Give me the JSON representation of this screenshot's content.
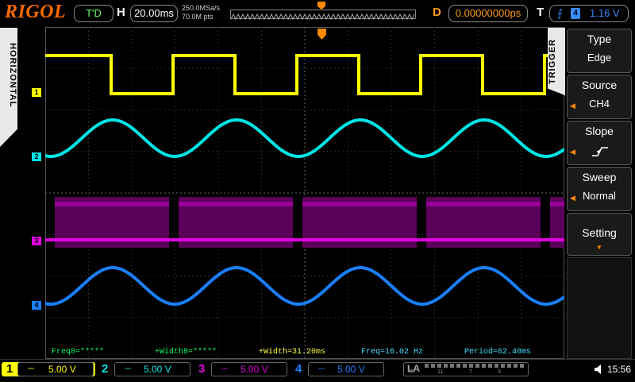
{
  "top": {
    "logo": "RIGOL",
    "status": "T'D",
    "h_label": "H",
    "timebase": "20.00ms",
    "sample_rate": "250.0MSa/s",
    "memory_depth": "70.0M pts",
    "d_label": "D",
    "delay": "0.00000000ps",
    "t_label": "T",
    "trigger_source_num": "4",
    "trigger_level": "1.16 V"
  },
  "left_tab": {
    "label": "HORIZONTAL"
  },
  "right_panel": {
    "tab_label": "TRIGGER",
    "items": [
      {
        "title": "Type",
        "value": "Edge"
      },
      {
        "title": "Source",
        "value": "CH4"
      },
      {
        "title": "Slope",
        "value": ""
      },
      {
        "title": "Sweep",
        "value": "Normal"
      },
      {
        "title": "Setting",
        "value": ""
      }
    ]
  },
  "channels": {
    "markers": [
      "1",
      "2",
      "3",
      "4"
    ],
    "colors": [
      "#ffff00",
      "#00e5e5",
      "#e000e0",
      "#1a7fff"
    ]
  },
  "measurements": [
    {
      "text": "Freq8=*****",
      "color": "#00ff66"
    },
    {
      "text": "+Width8=*****",
      "color": "#00ff66"
    },
    {
      "text": "+Width=31.20ms",
      "color": "#ffff40"
    },
    {
      "text": "Freq=16.02 Hz",
      "color": "#40e0ff"
    },
    {
      "text": "Period=62.40ms",
      "color": "#40e0ff"
    }
  ],
  "bottom": {
    "ch1": {
      "num": "1",
      "scale": "5.00 V"
    },
    "ch2": {
      "num": "2",
      "scale": "5.00 V"
    },
    "ch3": {
      "num": "3",
      "scale": "5.00 V"
    },
    "ch4": {
      "num": "4",
      "scale": "5.00 V"
    },
    "la_label": "LA",
    "la_ticks": [
      "15",
      "11",
      "7",
      "3"
    ],
    "time": "15:56"
  }
}
